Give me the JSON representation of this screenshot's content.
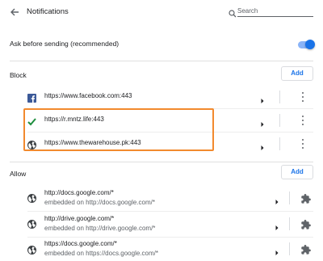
{
  "header": {
    "title": "Notifications",
    "search_placeholder": "Search",
    "back_icon": "arrow-left-icon",
    "search_icon": "search-icon"
  },
  "ask": {
    "label": "Ask before sending (recommended)",
    "enabled": true
  },
  "block": {
    "label": "Block",
    "add_label": "Add",
    "sites": [
      {
        "url": "https://www.facebook.com:443",
        "icon": "facebook-icon"
      },
      {
        "url": "https://r.mntz.life:443",
        "icon": "green-check-icon"
      },
      {
        "url": "https://www.thewarehouse.pk:443",
        "icon": "globe-icon"
      }
    ]
  },
  "allow": {
    "label": "Allow",
    "add_label": "Add",
    "sites": [
      {
        "url": "http://docs.google.com/*",
        "sub": "embedded on http://docs.google.com/*",
        "icon": "globe-icon"
      },
      {
        "url": "http://drive.google.com/*",
        "sub": "embedded on http://drive.google.com/*",
        "icon": "globe-icon"
      },
      {
        "url": "https://docs.google.com/*",
        "sub": "embedded on https://docs.google.com/*",
        "icon": "globe-icon"
      }
    ]
  },
  "colors": {
    "accent": "#1a73e8",
    "highlight": "#f28a2e",
    "check": "#1e8e3e",
    "facebook": "#3b5998"
  }
}
